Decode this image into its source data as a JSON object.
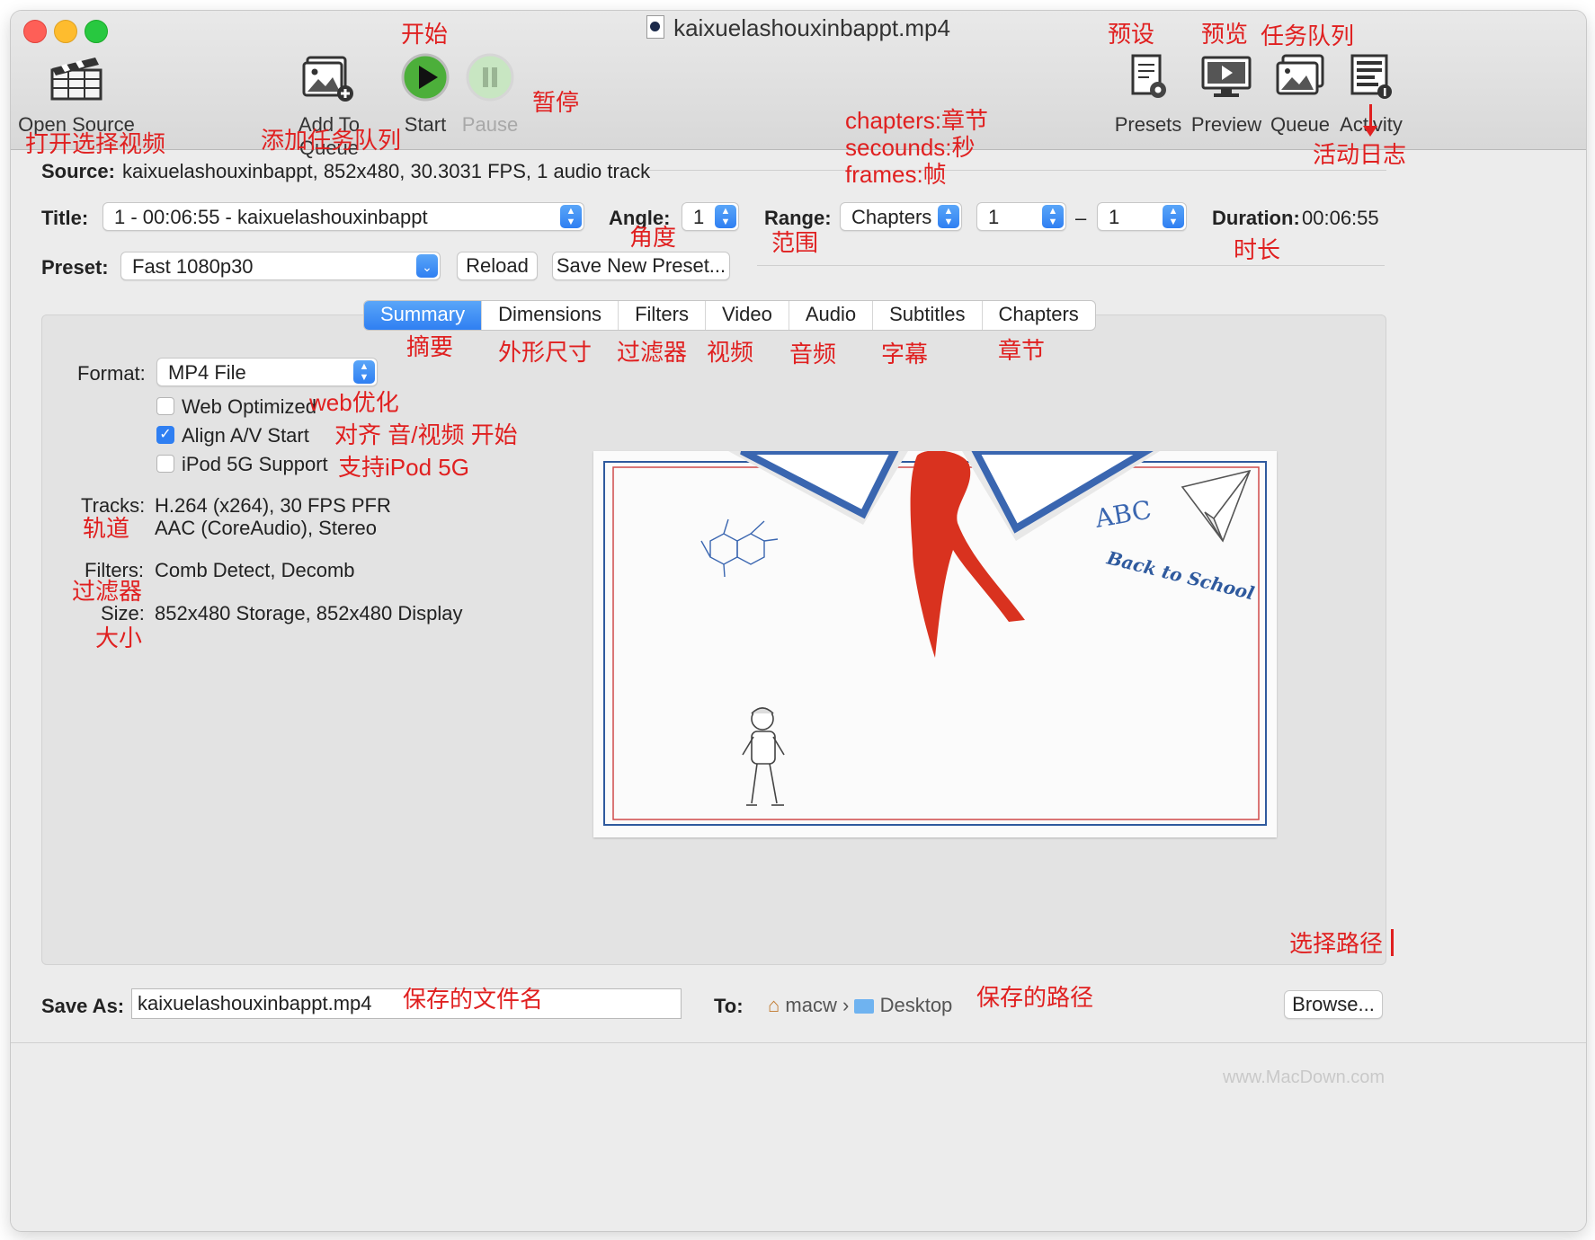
{
  "window": {
    "title": "kaixuelashouxinbappt.mp4"
  },
  "toolbar": {
    "open_source": "Open Source",
    "add_to_queue": "Add To Queue",
    "start": "Start",
    "pause": "Pause",
    "presets": "Presets",
    "preview": "Preview",
    "queue": "Queue",
    "activity": "Activity"
  },
  "source": {
    "label": "Source:",
    "value": "kaixuelashouxinbappt, 852x480, 30.3031 FPS, 1 audio track"
  },
  "title_row": {
    "title_label": "Title:",
    "title_value": "1 - 00:06:55 - kaixuelashouxinbappt",
    "angle_label": "Angle:",
    "angle_value": "1",
    "range_label": "Range:",
    "range_type": "Chapters",
    "range_start": "1",
    "range_dash": "–",
    "range_end": "1",
    "duration_label": "Duration:",
    "duration_value": "00:06:55"
  },
  "preset_row": {
    "label": "Preset:",
    "value": "Fast 1080p30",
    "reload": "Reload",
    "save_new": "Save New Preset..."
  },
  "tabs": [
    "Summary",
    "Dimensions",
    "Filters",
    "Video",
    "Audio",
    "Subtitles",
    "Chapters"
  ],
  "summary": {
    "format_label": "Format:",
    "format_value": "MP4 File",
    "web_optimized": {
      "label": "Web Optimized",
      "checked": false
    },
    "align_av": {
      "label": "Align A/V Start",
      "checked": true
    },
    "ipod": {
      "label": "iPod 5G Support",
      "checked": false
    },
    "tracks_label": "Tracks:",
    "tracks_line1": "H.264 (x264), 30 FPS PFR",
    "tracks_line2": "AAC (CoreAudio), Stereo",
    "filters_label": "Filters:",
    "filters_value": "Comb Detect, Decomb",
    "size_label": "Size:",
    "size_value": "852x480 Storage, 852x480 Display"
  },
  "preview_image": {
    "text1": "ABC",
    "text2": "Back to School"
  },
  "save": {
    "label": "Save As:",
    "filename": "kaixuelashouxinbappt.mp4",
    "to_label": "To:",
    "path_home": "macw",
    "path_sep": "›",
    "path_folder": "Desktop",
    "browse": "Browse..."
  },
  "annotations": {
    "open_source": "打开选择视频",
    "add_queue": "添加任务队列",
    "start": "开始",
    "pause": "暂停",
    "presets": "预设",
    "preview": "预览",
    "queue": "任务队列",
    "activity": "活动日志",
    "chapters_note": "chapters:章节",
    "seconds_note": "secounds:秒",
    "frames_note": "frames:帧",
    "angle": "角度",
    "range": "范围",
    "duration": "时长",
    "tab_summary": "摘要",
    "tab_dimensions": "外形尺寸",
    "tab_filters": "过滤器",
    "tab_video": "视频",
    "tab_audio": "音频",
    "tab_subtitles": "字幕",
    "tab_chapters": "章节",
    "web_optimized": "web优化",
    "align_av": "对齐 音/视频 开始",
    "ipod": "支持iPod 5G",
    "tracks": "轨道",
    "filters": "过滤器",
    "size": "大小",
    "choose_path": "选择路径",
    "save_filename": "保存的文件名",
    "save_path": "保存的路径"
  },
  "watermark": "www.MacDown.com",
  "colors": {
    "accent": "#2f7ff2",
    "annotation": "#e02020",
    "start_green": "#4caf3a"
  }
}
